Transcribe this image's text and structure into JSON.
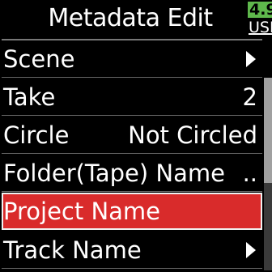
{
  "header": {
    "title": "Metadata Edit",
    "battery": {
      "level": "4.9",
      "source": "USB",
      "color": "#5fb84c"
    }
  },
  "menu": {
    "items": [
      {
        "label": "Scene",
        "value": "",
        "submenu": true
      },
      {
        "label": "Take",
        "value": "2",
        "submenu": false
      },
      {
        "label": "Circle",
        "value": "Not Circled",
        "submenu": false
      },
      {
        "label": "Folder(Tape) Name",
        "value": "..",
        "submenu": false
      },
      {
        "label": "Project Name",
        "value": "",
        "submenu": false,
        "selected": true
      },
      {
        "label": "Track Name",
        "value": "",
        "submenu": true
      }
    ],
    "highlight_color": "#d92b2b"
  }
}
